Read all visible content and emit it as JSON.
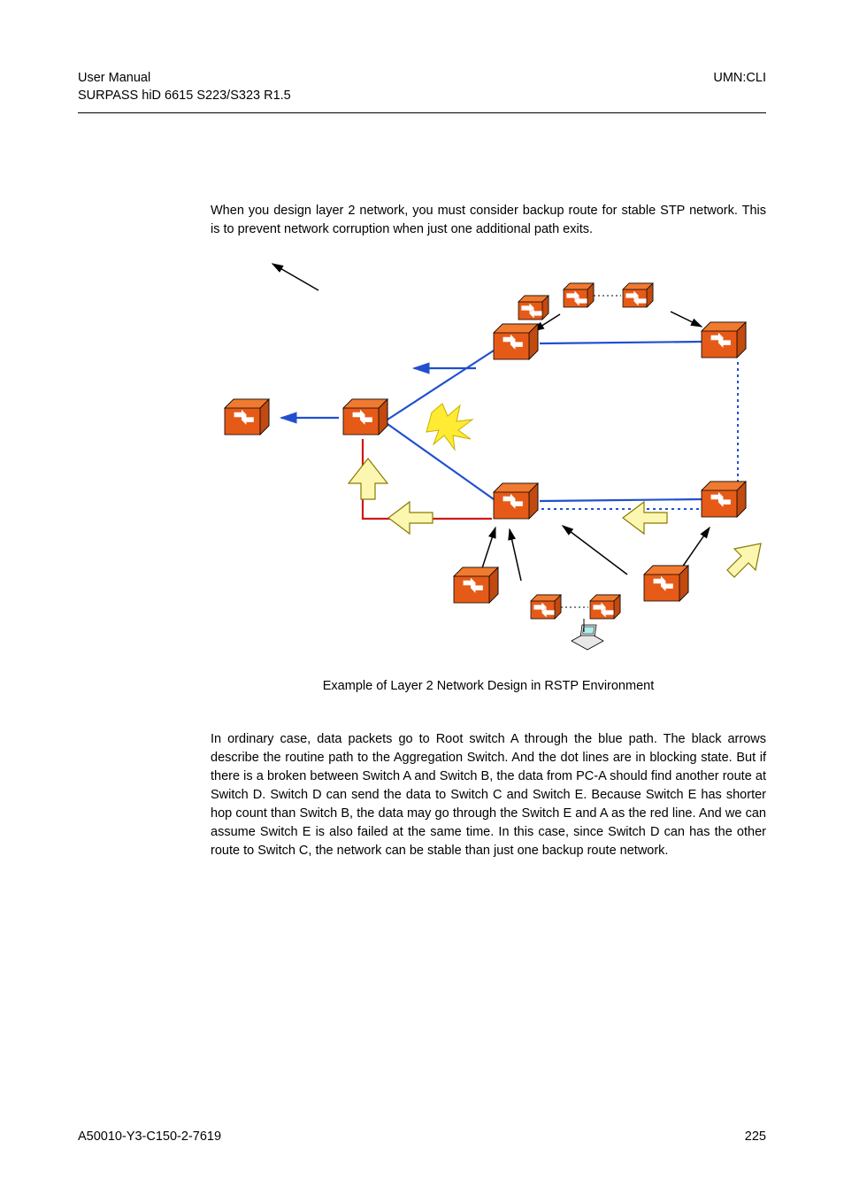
{
  "header": {
    "left_line1": "User  Manual",
    "left_line2": "SURPASS hiD 6615 S223/S323 R1.5",
    "right": "UMN:CLI"
  },
  "body": {
    "para1": "When you design layer 2 network, you must consider backup route for stable STP network. This is to prevent network corruption when just one additional path exits.",
    "caption": "Example of Layer 2 Network Design in RSTP Environment",
    "para2": "In ordinary case, data packets go to Root switch A through the blue path. The black arrows describe the routine path to the Aggregation Switch. And the dot lines are in blocking state. But if there is a broken between Switch A and Switch B, the data from PC-A should find another route at Switch D. Switch D can send the data to Switch C and Switch E. Because Switch E has shorter hop count than Switch B, the data may go through the Switch E and A as the red line. And we can assume Switch E is also failed at the same time. In this case, since Switch D can has the other route to Switch C, the network can be stable than just one backup route network."
  },
  "footer": {
    "doc_id": "A50010-Y3-C150-2-7619",
    "page": "225"
  }
}
